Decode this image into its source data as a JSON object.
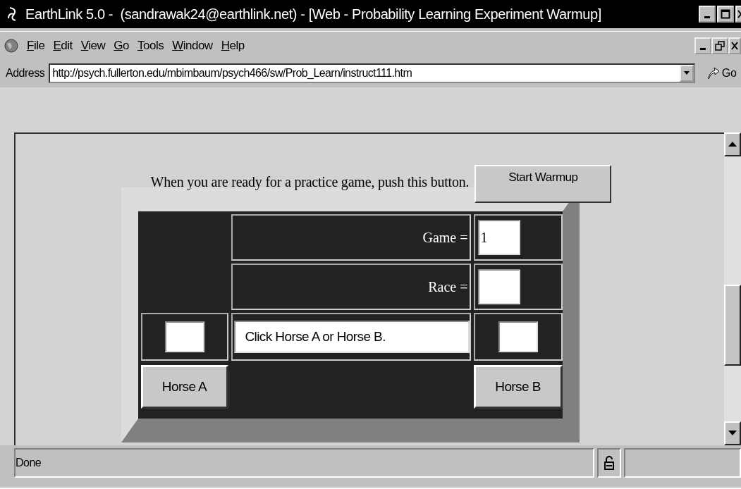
{
  "window": {
    "title": "EarthLink 5.0 -  (sandrawak24@earthlink.net) - [Web - Probability Learning Experiment Warmup]"
  },
  "menu": [
    {
      "label": "File"
    },
    {
      "label": "Edit"
    },
    {
      "label": "View"
    },
    {
      "label": "Go"
    },
    {
      "label": "Tools"
    },
    {
      "label": "Window"
    },
    {
      "label": "Help"
    }
  ],
  "address": {
    "label": "Address",
    "value": "http://psych.fullerton.edu/mbimbaum/psych466/sw/Prob_Learn/instruct111.htm",
    "go": "Go"
  },
  "page": {
    "prompt": "When you are ready for a practice game, push this button.",
    "start_button": "Start Warmup",
    "game_label": "Game =",
    "game_value": "1",
    "race_label": "Race =",
    "message": "Click Horse A or Horse B.",
    "horse_buttons": [
      "Horse A",
      "Horse B"
    ]
  },
  "status_bar": {
    "text": "Done"
  }
}
